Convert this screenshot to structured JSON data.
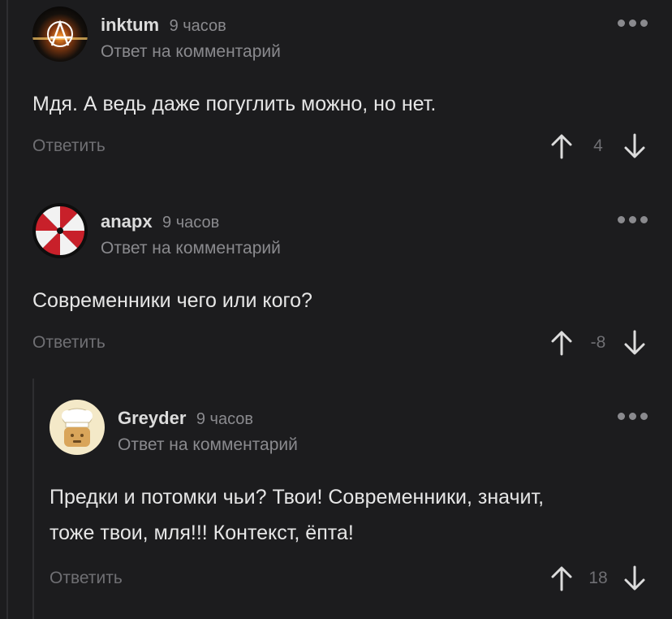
{
  "comments": [
    {
      "username": "inktum",
      "time": "9 часов",
      "subline": "Ответ на комментарий",
      "text": "Мдя. А ведь даже погуглить можно, но нет.",
      "reply_label": "Ответить",
      "score": "4",
      "avatar_icon": "anarchy-icon"
    },
    {
      "username": "anapx",
      "time": "9 часов",
      "subline": "Ответ на комментарий",
      "text": "Современники чего или кого?",
      "reply_label": "Ответить",
      "score": "-8",
      "avatar_icon": "umbrella-logo-icon"
    },
    {
      "username": "Greyder",
      "time": "9 часов",
      "subline": "Ответ на комментарий",
      "text_line1": "Предки и потомки чьи? Твои! Современники, значит,",
      "text_line2": "тоже твои, мля!!! Контекст, ёпта!",
      "reply_label": "Ответить",
      "score": "18",
      "avatar_icon": "chef-hat-icon"
    }
  ],
  "colors": {
    "background": "#1c1c1e",
    "text": "#e6e6e6",
    "muted": "#8a8a8e",
    "arrow": "#dcdcdc"
  }
}
